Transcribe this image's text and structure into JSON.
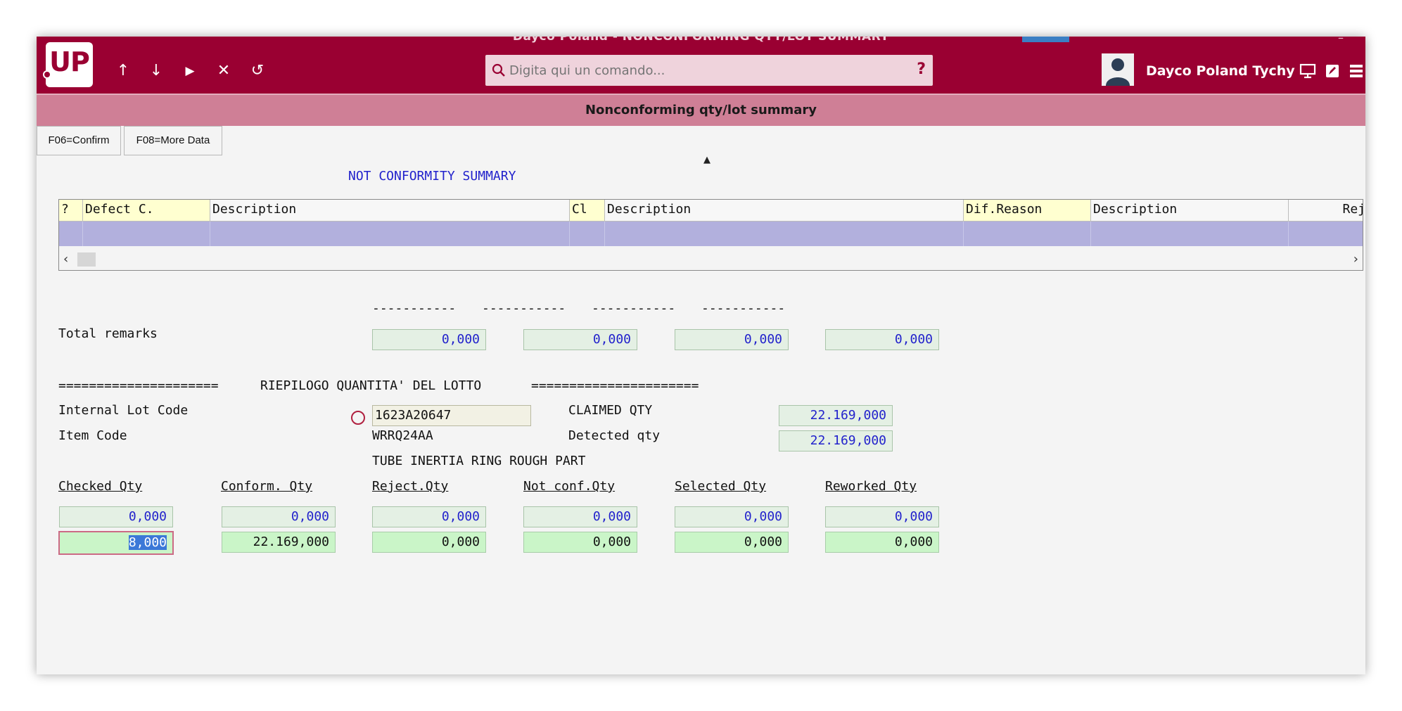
{
  "window": {
    "title": "Dayco Poland - NONCONFORMING QTY/LOT SUMMARY"
  },
  "topbar": {
    "logo": "UP",
    "search_placeholder": "Digita qui un comando...",
    "help": "?",
    "user_name": "Dayco Poland Tychy",
    "nav": {
      "up": "↑",
      "down": "↓",
      "run": "▶",
      "close": "✕",
      "undo": "↺"
    }
  },
  "subheader": {
    "title": "Nonconforming qty/lot summary"
  },
  "function_keys": {
    "confirm": "F06=Confirm",
    "more_data": "F08=More Data"
  },
  "section_title": "NOT CONFORMITY SUMMARY",
  "grid": {
    "columns": [
      "?",
      "Defect C.",
      "Description",
      "Cl",
      "Description",
      "Dif.Reason",
      "Description",
      "Rej"
    ]
  },
  "totals": {
    "dashes": [
      "-----------",
      "-----------",
      "-----------",
      "-----------"
    ],
    "label": "Total remarks",
    "values": [
      "0,000",
      "0,000",
      "0,000",
      "0,000"
    ]
  },
  "lot_summary": {
    "separator_left": "=====================",
    "title": "RIEPILOGO QUANTITA' DEL LOTTO",
    "separator_right": "======================",
    "internal_lot_label": "Internal Lot Code",
    "internal_lot_value": "1623A20647",
    "item_code_label": "Item Code",
    "item_code_value": "WRRQ24AA",
    "item_description": "TUBE INERTIA RING ROUGH PART",
    "claimed_label": "CLAIMED QTY",
    "claimed_value": "22.169,000",
    "detected_label": "Detected qty",
    "detected_value": "22.169,000"
  },
  "qty": {
    "headers": [
      "Checked Qty",
      "Conform. Qty",
      "Reject.Qty",
      "Not conf.Qty",
      "Selected Qty",
      "Reworked Qty"
    ],
    "row1": [
      "0,000",
      "0,000",
      "0,000",
      "0,000",
      "0,000",
      "0,000"
    ],
    "row2_checked": "8,000",
    "row2": [
      "22.169,000",
      "0,000",
      "0,000",
      "0,000",
      "0,000"
    ]
  }
}
